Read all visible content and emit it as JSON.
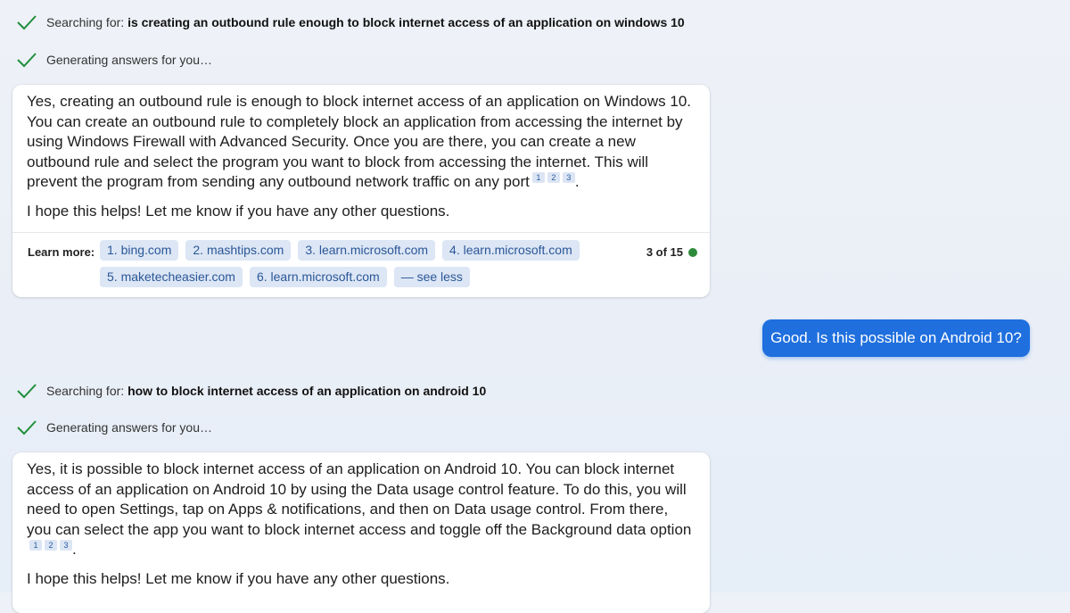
{
  "turn1": {
    "search_prefix": "Searching for:",
    "search_query": "is creating an outbound rule enough to block internet access of an application on windows 10",
    "generating": "Generating answers for you…",
    "answer": "Yes, creating an outbound rule is enough to block internet access of an application on Windows 10. You can create an outbound rule to completely block an application from accessing the internet by using Windows Firewall with Advanced Security. Once you are there, you can create a new outbound rule and select the program you want to block from accessing the internet. This will prevent the program from sending any outbound network traffic on any port",
    "citations": [
      "1",
      "2",
      "3"
    ],
    "closing": "I hope this helps! Let me know if you have any other questions.",
    "learn_more_label": "Learn more:",
    "sources": [
      "1. bing.com",
      "2. mashtips.com",
      "3. learn.microsoft.com",
      "4. learn.microsoft.com",
      "5. maketecheasier.com",
      "6. learn.microsoft.com",
      "— see less"
    ],
    "counter": "3 of 15"
  },
  "user_message": "Good. Is this possible on Android 10?",
  "turn2": {
    "search_prefix": "Searching for:",
    "search_query": "how to block internet access of an application on android 10",
    "generating": "Generating answers for you…",
    "answer": "Yes, it is possible to block internet access of an application on Android 10. You can block internet access of an application on Android 10 by using the Data usage control feature. To do this, you will need to open Settings, tap on Apps & notifications, and then on Data usage control. From there, you can select the app you want to block internet access and toggle off the Background data option",
    "citations": [
      "1",
      "2",
      "3"
    ],
    "closing": "I hope this helps! Let me know if you have any other questions."
  },
  "colors": {
    "check": "#1f8f3a",
    "user_bubble": "#1f6fde",
    "chip_bg": "#dce6f5",
    "chip_text": "#2b5797",
    "status_dot": "#2e8b3a"
  }
}
